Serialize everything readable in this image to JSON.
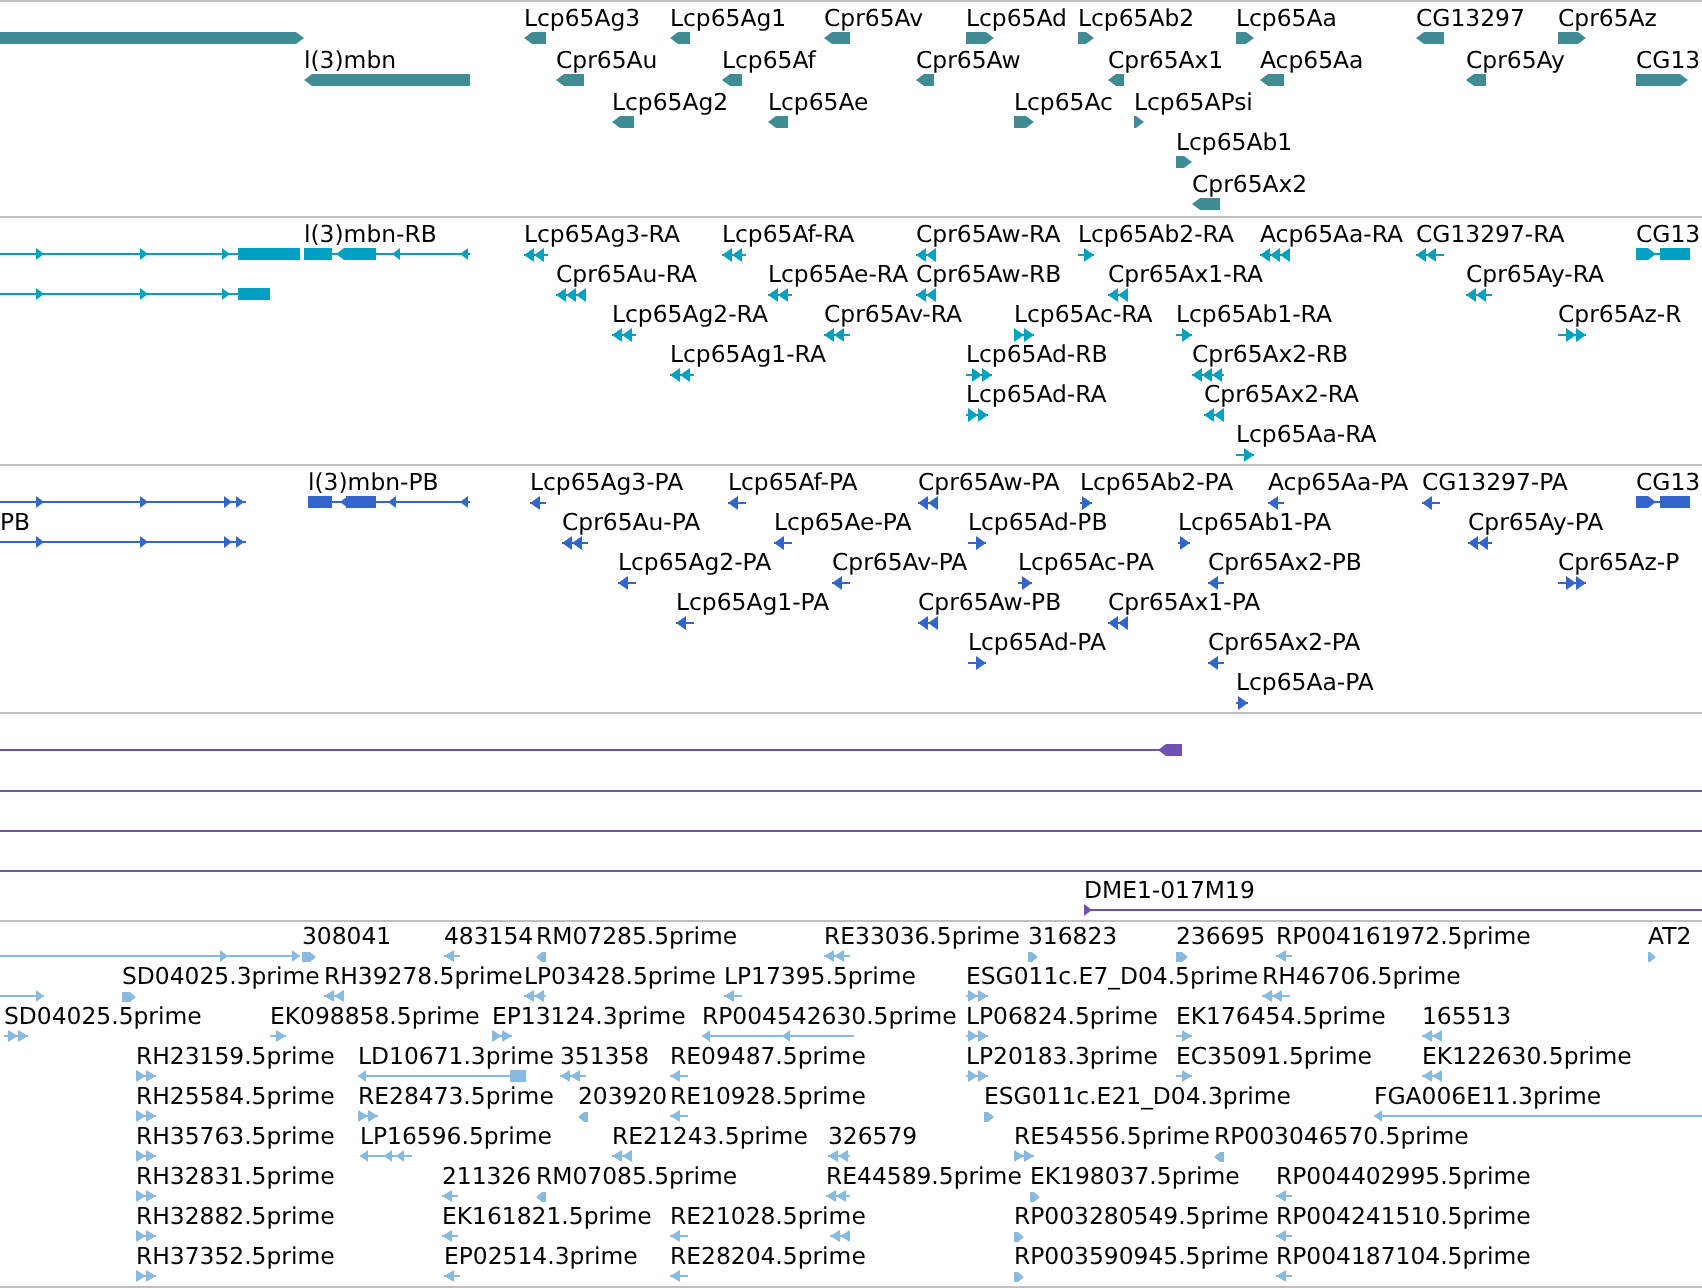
{
  "tracks": [
    {
      "kind": "gene",
      "color": "#408c94",
      "features": [
        {
          "reverse": false
        },
        {
          "label": "Lcp65Ag3",
          "reverse": true
        },
        {
          "label": "Lcp65Ag1",
          "reverse": true
        },
        {
          "label": "Cpr65Av",
          "reverse": true
        },
        {
          "label": "Lcp65Ad",
          "reverse": false
        },
        {
          "label": "Lcp65Ab2",
          "reverse": false
        },
        {
          "label": "Lcp65Aa",
          "reverse": false
        },
        {
          "label": "CG13297",
          "reverse": true
        },
        {
          "label": "Cpr65Az",
          "reverse": false
        },
        {
          "label": "l(3)mbn",
          "reverse": true
        },
        {
          "label": "Cpr65Au",
          "reverse": true
        },
        {
          "label": "Lcp65Af",
          "reverse": true
        },
        {
          "label": "Cpr65Aw",
          "reverse": true
        },
        {
          "label": "Cpr65Ax1",
          "reverse": true
        },
        {
          "label": "Acp65Aa",
          "reverse": true
        },
        {
          "label": "Cpr65Ay",
          "reverse": true
        },
        {
          "label": "CG13",
          "reverse": false
        },
        {
          "label": "Lcp65Ag2",
          "reverse": true
        },
        {
          "label": "Lcp65Ae",
          "reverse": true
        },
        {
          "label": "Lcp65Ac",
          "reverse": false
        },
        {
          "label": "Lcp65APsi",
          "reverse": false
        },
        {
          "label": "Lcp65Ab1",
          "reverse": false
        },
        {
          "label": "Cpr65Ax2",
          "reverse": true
        }
      ]
    },
    {
      "kind": "transcript",
      "color": "#00a0c0",
      "features": [
        {
          "reverse": false
        },
        {
          "label": "l(3)mbn-RB",
          "reverse": true
        },
        {
          "label": "Lcp65Ag3-RA",
          "reverse": true
        },
        {
          "label": "Lcp65Af-RA",
          "reverse": true
        },
        {
          "label": "Cpr65Aw-RA",
          "reverse": true
        },
        {
          "label": "Lcp65Ab2-RA",
          "reverse": false
        },
        {
          "label": "Acp65Aa-RA",
          "reverse": true
        },
        {
          "label": "CG13297-RA",
          "reverse": true
        },
        {
          "label": "CG13",
          "reverse": false
        },
        {
          "reverse": false
        },
        {
          "label": "Cpr65Au-RA",
          "reverse": true
        },
        {
          "label": "Lcp65Ae-RA",
          "reverse": true
        },
        {
          "label": "Cpr65Aw-RB",
          "reverse": true
        },
        {
          "label": "Cpr65Ax1-RA",
          "reverse": true
        },
        {
          "label": "Cpr65Ay-RA",
          "reverse": true
        },
        {
          "label": "Lcp65Ag2-RA",
          "reverse": true
        },
        {
          "label": "Cpr65Av-RA",
          "reverse": true
        },
        {
          "label": "Lcp65Ac-RA",
          "reverse": false
        },
        {
          "label": "Lcp65Ab1-RA",
          "reverse": false
        },
        {
          "label": "Cpr65Az-R",
          "reverse": false
        },
        {
          "label": "Lcp65Ag1-RA",
          "reverse": true
        },
        {
          "label": "Lcp65Ad-RB",
          "reverse": false
        },
        {
          "label": "Cpr65Ax2-RB",
          "reverse": true
        },
        {
          "label": "Lcp65Ad-RA",
          "reverse": false
        },
        {
          "label": "Cpr65Ax2-RA",
          "reverse": true
        },
        {
          "label": "Lcp65Aa-RA",
          "reverse": false
        }
      ]
    },
    {
      "kind": "transcript",
      "color": "#3366cc",
      "features": [
        {
          "reverse": false
        },
        {
          "label": "l(3)mbn-PB",
          "reverse": true
        },
        {
          "label": "Lcp65Ag3-PA",
          "reverse": true
        },
        {
          "label": "Lcp65Af-PA",
          "reverse": true
        },
        {
          "label": "Cpr65Aw-PA",
          "reverse": true
        },
        {
          "label": "Lcp65Ab2-PA",
          "reverse": false
        },
        {
          "label": "Acp65Aa-PA",
          "reverse": true
        },
        {
          "label": "CG13297-PA",
          "reverse": true
        },
        {
          "label": "CG13",
          "reverse": false
        },
        {
          "label": "PB",
          "reverse": false
        },
        {
          "label": "Cpr65Au-PA",
          "reverse": true
        },
        {
          "label": "Lcp65Ae-PA",
          "reverse": true
        },
        {
          "label": "Lcp65Ad-PB",
          "reverse": false
        },
        {
          "label": "Lcp65Ab1-PA",
          "reverse": false
        },
        {
          "label": "Cpr65Ay-PA",
          "reverse": true
        },
        {
          "label": "Lcp65Ag2-PA",
          "reverse": true
        },
        {
          "label": "Cpr65Av-PA",
          "reverse": true
        },
        {
          "label": "Lcp65Ac-PA",
          "reverse": false
        },
        {
          "label": "Cpr65Ax2-PB",
          "reverse": true
        },
        {
          "label": "Cpr65Az-P",
          "reverse": false
        },
        {
          "label": "Lcp65Ag1-PA",
          "reverse": true
        },
        {
          "label": "Cpr65Aw-PB",
          "reverse": true
        },
        {
          "label": "Cpr65Ax1-PA",
          "reverse": true
        },
        {
          "label": "Lcp65Ad-PA",
          "reverse": false
        },
        {
          "label": "Cpr65Ax2-PA",
          "reverse": true
        },
        {
          "label": "Lcp65Aa-PA",
          "reverse": false
        }
      ]
    },
    {
      "kind": "clone",
      "color": "#7050b0",
      "features": [
        {
          "reverse": true
        },
        {
          "stranded": false
        },
        {
          "stranded": false
        },
        {
          "stranded": false
        },
        {
          "label": "DME1-017M19",
          "reverse": false
        }
      ]
    },
    {
      "kind": "est",
      "color": "#87b9e1",
      "features": [
        {
          "reverse": false
        },
        {
          "label": "308041",
          "reverse": false
        },
        {
          "label": "483154",
          "reverse": true
        },
        {
          "label": "RM07285.5prime",
          "reverse": true
        },
        {
          "label": "RE33036.5prime",
          "reverse": true
        },
        {
          "label": "316823",
          "reverse": false
        },
        {
          "label": "236695",
          "reverse": false
        },
        {
          "label": "RP004161972.5prime",
          "reverse": true
        },
        {
          "label": "AT2",
          "reverse": false
        },
        {
          "reverse": false
        },
        {
          "label": "SD04025.3prime",
          "reverse": false
        },
        {
          "label": "RH39278.5prime",
          "reverse": true
        },
        {
          "label": "LP03428.5prime",
          "reverse": true
        },
        {
          "label": "LP17395.5prime",
          "reverse": true
        },
        {
          "label": "ESG011c.E7_D04.5prime",
          "reverse": false
        },
        {
          "label": "RH46706.5prime",
          "reverse": true
        },
        {
          "label": "SD04025.5prime",
          "reverse": false
        },
        {
          "label": "EK098858.5prime",
          "reverse": false
        },
        {
          "label": "EP13124.3prime",
          "reverse": false
        },
        {
          "label": "RP004542630.5prime",
          "reverse": true
        },
        {
          "label": "LP06824.5prime",
          "reverse": false
        },
        {
          "label": "EK176454.5prime",
          "reverse": false
        },
        {
          "label": "165513",
          "reverse": true
        },
        {
          "label": "RH23159.5prime",
          "reverse": false
        },
        {
          "label": "LD10671.3prime",
          "reverse": true
        },
        {
          "label": "351358",
          "reverse": true
        },
        {
          "label": "RE09487.5prime",
          "reverse": true
        },
        {
          "label": "LP20183.3prime",
          "reverse": false
        },
        {
          "label": "EC35091.5prime",
          "reverse": false
        },
        {
          "label": "EK122630.5prime",
          "reverse": true
        },
        {
          "label": "RH25584.5prime",
          "reverse": false
        },
        {
          "label": "RE28473.5prime",
          "reverse": false
        },
        {
          "label": "203920",
          "reverse": true
        },
        {
          "label": "RE10928.5prime",
          "reverse": true
        },
        {
          "label": "ESG011c.E21_D04.3prime",
          "reverse": false
        },
        {
          "label": "FGA006E11.3prime",
          "reverse": true
        },
        {
          "label": "RH35763.5prime",
          "reverse": false
        },
        {
          "label": "LP16596.5prime",
          "reverse": true
        },
        {
          "label": "RE21243.5prime",
          "reverse": true
        },
        {
          "label": "326579",
          "reverse": true
        },
        {
          "label": "RE54556.5prime",
          "reverse": false
        },
        {
          "label": "RP003046570.5prime",
          "reverse": true
        },
        {
          "label": "RH32831.5prime",
          "reverse": false
        },
        {
          "label": "211326",
          "reverse": true
        },
        {
          "label": "RM07085.5prime",
          "reverse": true
        },
        {
          "label": "RE44589.5prime",
          "reverse": true
        },
        {
          "label": "EK198037.5prime",
          "reverse": false
        },
        {
          "label": "RP004402995.5prime",
          "reverse": true
        },
        {
          "label": "RH32882.5prime",
          "reverse": false
        },
        {
          "label": "EK161821.5prime",
          "reverse": true
        },
        {
          "label": "RE21028.5prime",
          "reverse": true
        },
        {
          "reverse": true
        },
        {
          "label": "RP003280549.5prime",
          "reverse": false
        },
        {
          "label": "RP004241510.5prime",
          "reverse": true
        },
        {
          "label": "RH37352.5prime",
          "reverse": false
        },
        {
          "label": "EP02514.3prime",
          "reverse": true
        },
        {
          "label": "RE28204.5prime",
          "reverse": true
        },
        {
          "label": "RP003590945.5prime",
          "reverse": false
        },
        {
          "label": "RP004187104.5prime",
          "reverse": true
        }
      ]
    }
  ]
}
